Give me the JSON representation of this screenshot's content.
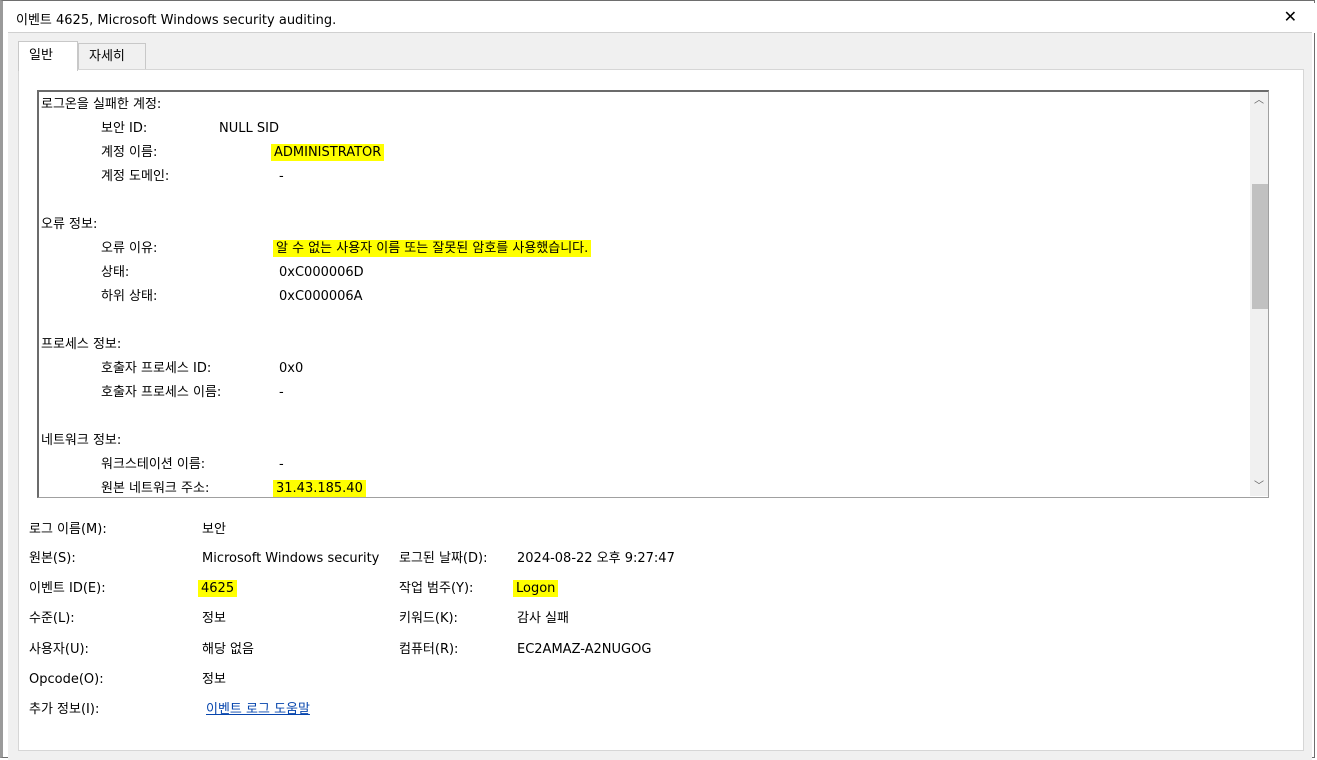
{
  "window": {
    "title": "이벤트 4625, Microsoft Windows security auditing."
  },
  "tabs": [
    {
      "label": "일반",
      "active": true
    },
    {
      "label": "자세히",
      "active": false
    }
  ],
  "description": {
    "failed_account": {
      "heading": "로그온을 실패한 계정:",
      "security_id_label": "보안 ID:",
      "security_id_value": "NULL SID",
      "account_name_label": "계정 이름:",
      "account_name_value": "ADMINISTRATOR",
      "account_domain_label": "계정 도메인:",
      "account_domain_value": "-"
    },
    "failure_info": {
      "heading": "오류 정보:",
      "reason_label": "오류 이유:",
      "reason_value": "알 수 없는 사용자 이름 또는 잘못된 암호를 사용했습니다.",
      "status_label": "상태:",
      "status_value": "0xC000006D",
      "sub_status_label": "하위 상태:",
      "sub_status_value": "0xC000006A"
    },
    "process_info": {
      "heading": "프로세스 정보:",
      "caller_pid_label": "호출자 프로세스 ID:",
      "caller_pid_value": "0x0",
      "caller_name_label": "호출자 프로세스 이름:",
      "caller_name_value": "-"
    },
    "network_info": {
      "heading": "네트워크 정보:",
      "workstation_label": "워크스테이션 이름:",
      "workstation_value": "-",
      "source_address_label": "원본 네트워크 주소:",
      "source_address_value": "31.43.185.40"
    }
  },
  "properties": {
    "log_name_label": "로그 이름(M):",
    "log_name_value": "보안",
    "source_label": "원본(S):",
    "source_value": "Microsoft Windows security",
    "logged_label": "로그된 날짜(D):",
    "logged_value": "2024-08-22 오후 9:27:47",
    "event_id_label": "이벤트 ID(E):",
    "event_id_value": "4625",
    "task_category_label": "작업 범주(Y):",
    "task_category_value": "Logon",
    "level_label": "수준(L):",
    "level_value": "정보",
    "keywords_label": "키워드(K):",
    "keywords_value": "감사 실패",
    "user_label": "사용자(U):",
    "user_value": "해당 없음",
    "computer_label": "컴퓨터(R):",
    "computer_value": "EC2AMAZ-A2NUGOG",
    "opcode_label": "Opcode(O):",
    "opcode_value": "정보",
    "more_info_label": "추가 정보(I):",
    "more_info_link": "이벤트 로그 도움말"
  },
  "icons": {
    "close": "close-icon",
    "scroll_up": "chevron-up-icon",
    "scroll_down": "chevron-down-icon"
  },
  "colors": {
    "highlight": "#ffff00",
    "link": "#0645ad"
  }
}
